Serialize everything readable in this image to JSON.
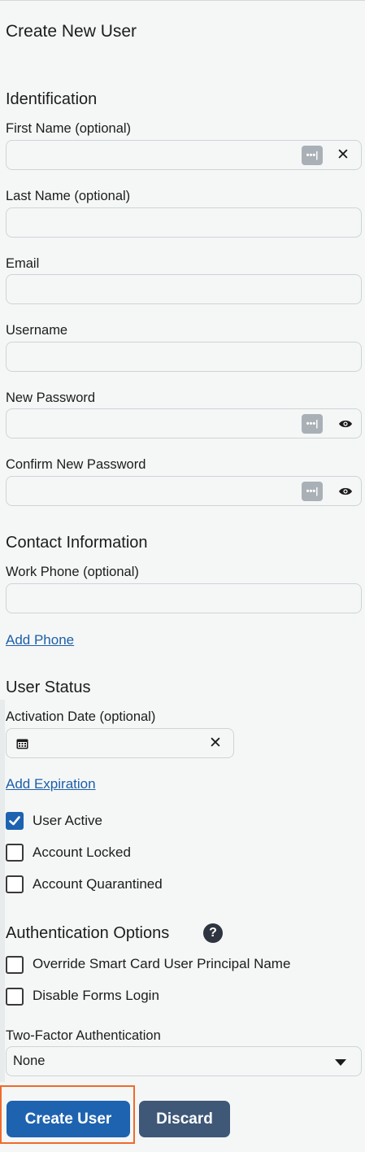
{
  "page": {
    "title": "Create New User"
  },
  "identification": {
    "heading": "Identification",
    "first_name": {
      "label": "First Name (optional)",
      "value": ""
    },
    "last_name": {
      "label": "Last Name (optional)",
      "value": ""
    },
    "email": {
      "label": "Email",
      "value": ""
    },
    "username": {
      "label": "Username",
      "value": ""
    },
    "new_password": {
      "label": "New Password",
      "value": ""
    },
    "confirm_password": {
      "label": "Confirm New Password",
      "value": ""
    }
  },
  "contact": {
    "heading": "Contact Information",
    "work_phone": {
      "label": "Work Phone (optional)",
      "value": ""
    },
    "add_phone": "Add Phone"
  },
  "status": {
    "heading": "User Status",
    "activation_date": {
      "label": "Activation Date (optional)",
      "value": ""
    },
    "add_expiration": "Add Expiration",
    "user_active": {
      "label": "User Active",
      "checked": true
    },
    "account_locked": {
      "label": "Account Locked",
      "checked": false
    },
    "account_quarantined": {
      "label": "Account Quarantined",
      "checked": false
    }
  },
  "auth": {
    "heading": "Authentication Options",
    "help": "?",
    "override_smart_card": {
      "label": "Override Smart Card User Principal Name",
      "checked": false
    },
    "disable_forms_login": {
      "label": "Disable Forms Login",
      "checked": false
    },
    "two_factor": {
      "label": "Two-Factor Authentication",
      "value": "None"
    }
  },
  "actions": {
    "create": "Create User",
    "discard": "Discard"
  },
  "icons": {
    "password_manager": "password-manager-icon",
    "clear": "close-icon",
    "reveal": "eye-icon",
    "calendar": "calendar-icon",
    "dropdown": "caret-down-icon",
    "check": "checkmark-icon"
  },
  "colors": {
    "primary": "#1e63b0",
    "secondary": "#3f5878",
    "focus": "#f06a2a",
    "link": "#1d5fa8"
  }
}
